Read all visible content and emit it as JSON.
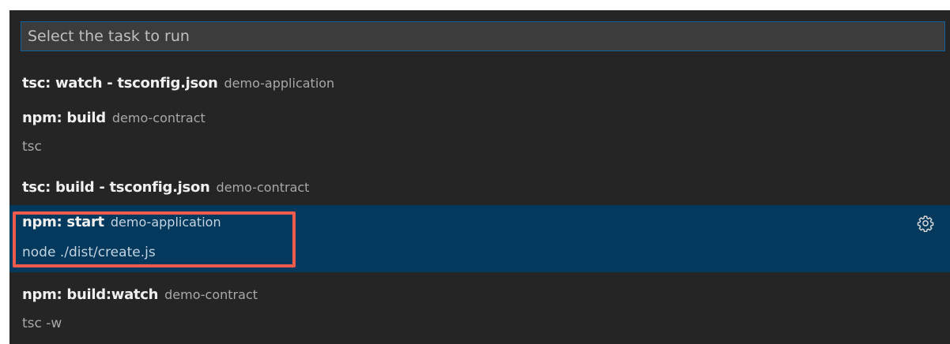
{
  "quick_pick": {
    "placeholder": "Select the task to run",
    "items": [
      {
        "label": "tsc: watch - tsconfig.json",
        "description": "demo-application",
        "detail": ""
      },
      {
        "label": "npm: build",
        "description": "demo-contract",
        "detail": "tsc"
      },
      {
        "label": "tsc: build - tsconfig.json",
        "description": "demo-contract",
        "detail": ""
      },
      {
        "label": "npm: start",
        "description": "demo-application",
        "detail": "node ./dist/create.js",
        "selected": true,
        "action_icon": "gear-icon"
      },
      {
        "label": "npm: build:watch",
        "description": "demo-contract",
        "detail": "tsc -w"
      }
    ]
  },
  "colors": {
    "panel_bg": "#252526",
    "input_bg": "#3c3c3c",
    "input_border": "#0e639c",
    "selected_bg": "#04395e",
    "highlight_border": "#ee5b4d"
  }
}
